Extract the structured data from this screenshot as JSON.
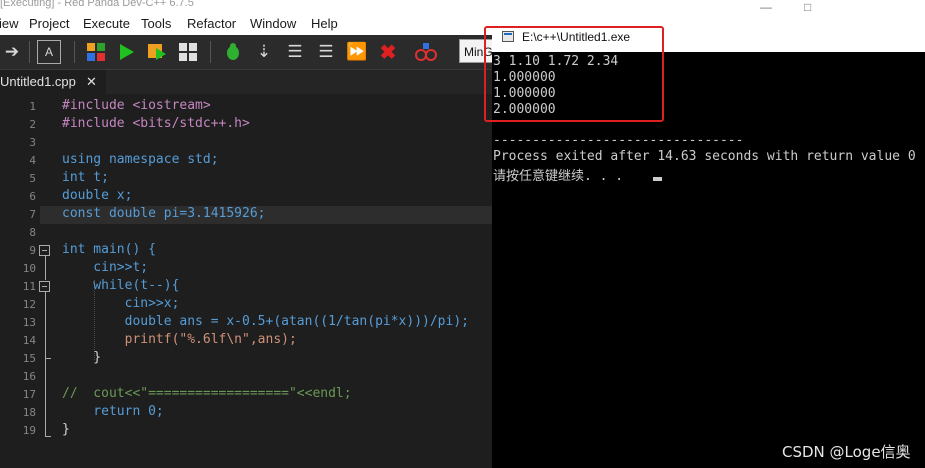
{
  "ide": {
    "title": "[Executing] - Red Panda Dev-C++ 6.7.5",
    "menu": [
      "iew",
      "Project",
      "Execute",
      "Tools",
      "Refactor",
      "Window",
      "Help"
    ],
    "compiler": "MinG",
    "tab_filename": "Untitled1.cpp",
    "tab_close": "✕"
  },
  "toolbar": {
    "icons": [
      "arrow-right-icon",
      "format-icon",
      "compile-icon",
      "run-icon",
      "compile-run-icon",
      "rebuild-icon",
      "debug-icon",
      "step-icon",
      "indent-icon",
      "unindent-icon",
      "forward-icon",
      "stop-icon",
      "profile-icon"
    ]
  },
  "code": {
    "line_numbers": [
      "1",
      "2",
      "3",
      "4",
      "5",
      "6",
      "7",
      "8",
      "9",
      "10",
      "11",
      "12",
      "13",
      "14",
      "15",
      "16",
      "17",
      "18",
      "19"
    ],
    "lines": [
      "#include <iostream>",
      "#include <bits/stdc++.h>",
      "",
      "using namespace std;",
      "int t;",
      "double x;",
      "const double pi=3.1415926;",
      "",
      "int main() {",
      "    cin>>t;",
      "    while(t--){",
      "        cin>>x;",
      "        double ans = x-0.5+(atan((1/tan(pi*x)))/pi);",
      "        printf(\"%.6lf\\n\",ans);",
      "    }",
      "",
      "//  cout<<\"==================\"<<endl;",
      "    return 0;",
      "}"
    ]
  },
  "console": {
    "title": "E:\\c++\\Untitled1.exe",
    "lines": [
      "3 1.10 1.72 2.34",
      "1.000000",
      "1.000000",
      "2.000000",
      "",
      "--------------------------------",
      "Process exited after 14.63 seconds with return value 0",
      "请按任意键继续. . ."
    ]
  },
  "window_buttons": [
    "—",
    "□"
  ],
  "watermark": "CSDN @Loge信奥",
  "colors": {
    "highlight_box": "#e02020",
    "console_bg": "#000000",
    "editor_bg": "#1e1e1e"
  }
}
